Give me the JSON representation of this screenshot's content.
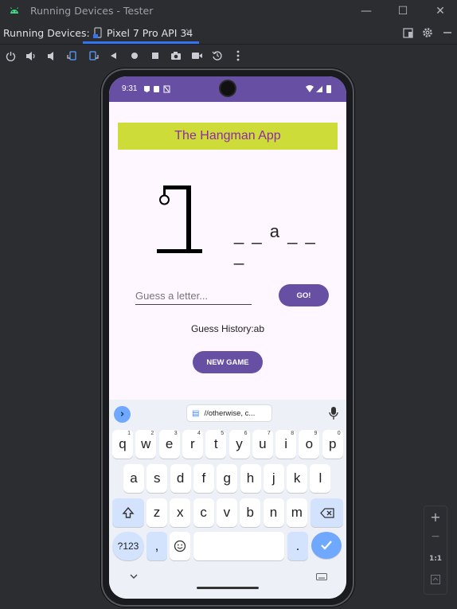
{
  "window": {
    "title": "Running Devices - Tester",
    "minimize": "—",
    "maximize": "☐",
    "close": "✕"
  },
  "tabbar": {
    "label": "Running Devices:",
    "device_tab": "Pixel 7 Pro API 34",
    "close": "✕"
  },
  "status": {
    "time": "9:31"
  },
  "app": {
    "title": "The Hangman App",
    "word_letters": [
      "_",
      "_",
      "a",
      "_",
      "_",
      "_"
    ],
    "guess_placeholder": "Guess a letter...",
    "go_label": "GO!",
    "history": "Guess History:ab",
    "new_game_label": "NEW GAME"
  },
  "keyboard": {
    "suggestion": "//otherwise, c...",
    "row1": [
      {
        "k": "q",
        "n": "1"
      },
      {
        "k": "w",
        "n": "2"
      },
      {
        "k": "e",
        "n": "3"
      },
      {
        "k": "r",
        "n": "4"
      },
      {
        "k": "t",
        "n": "5"
      },
      {
        "k": "y",
        "n": "6"
      },
      {
        "k": "u",
        "n": "7"
      },
      {
        "k": "i",
        "n": "8"
      },
      {
        "k": "o",
        "n": "9"
      },
      {
        "k": "p",
        "n": "0"
      }
    ],
    "row2": [
      "a",
      "s",
      "d",
      "f",
      "g",
      "h",
      "j",
      "k",
      "l"
    ],
    "row3": [
      "z",
      "x",
      "c",
      "v",
      "b",
      "n",
      "m"
    ],
    "sym_label": "?123",
    "comma": ",",
    "period": "."
  },
  "zoom": {
    "plus": "+",
    "minus": "−",
    "ratio": "1:1"
  },
  "colors": {
    "accent": "#6750a4",
    "title_bg": "#cddc39",
    "title_text": "#8e2ca3",
    "ide_bg": "#2b2d30"
  }
}
